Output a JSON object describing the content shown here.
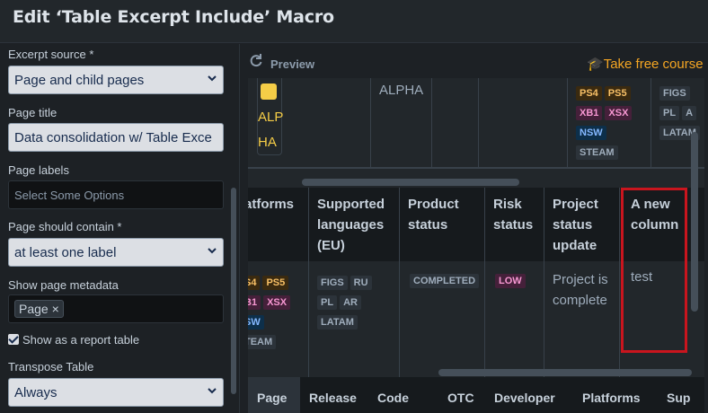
{
  "title": "Edit ‘Table Excerpt Include’ Macro",
  "form": {
    "excerpt_source": {
      "label": "Excerpt source *",
      "value": "Page and child pages"
    },
    "page_title": {
      "label": "Page title",
      "value": "Data consolidation w/ Table Exce"
    },
    "page_labels": {
      "label": "Page labels",
      "placeholder": "Select Some Options"
    },
    "page_should_contain": {
      "label": "Page should contain *",
      "value": "at least one label"
    },
    "show_page_metadata": {
      "label": "Show page metadata",
      "chip": "Page",
      "chip_remove": "×"
    },
    "show_as_report": {
      "label": "Show as a report table",
      "checked": true
    },
    "transpose": {
      "label": "Transpose Table",
      "value": "Always"
    }
  },
  "preview": {
    "label": "Preview",
    "course_link": "Take free course",
    "top_row": {
      "alp_lines": [
        "ALP",
        "HA"
      ],
      "alpha": "ALPHA",
      "tags_col1": [
        [
          "PS4",
          "PS5"
        ],
        [
          "XB1",
          "XSX"
        ],
        [
          "NSW"
        ],
        [
          "STEAM"
        ]
      ],
      "tags_col2": [
        [
          "FIGS"
        ],
        [
          "PL",
          "A"
        ],
        [
          "LATAM"
        ]
      ]
    },
    "headers": [
      "atforms",
      "Supported languages (EU)",
      "Product status",
      "Risk status",
      "Project status update",
      "A new column"
    ],
    "header_lines": {
      "c0": [
        "atforms"
      ],
      "c1": [
        "Supported",
        "languages",
        "(EU)"
      ],
      "c2": [
        "Product",
        "status"
      ],
      "c3": [
        "Risk",
        "status"
      ],
      "c4": [
        "Project",
        "status",
        "update"
      ],
      "c5": [
        "A new",
        "column"
      ]
    },
    "row": {
      "platform_tags": [
        [
          "S4",
          "PS5"
        ],
        [
          "B1",
          "XSX"
        ],
        [
          "SW"
        ],
        [
          "TEAM"
        ]
      ],
      "language_tags": [
        [
          "FIGS",
          "RU"
        ],
        [
          "PL",
          "AR"
        ],
        [
          "LATAM"
        ]
      ],
      "product_status": "COMPLETED",
      "risk_status": "LOW",
      "project_update": [
        "Project is",
        "complete"
      ],
      "new_column": "test"
    },
    "bottom_headers": [
      "Page",
      "Release",
      "Code",
      "OTC",
      "Developer",
      "Platforms",
      "Sup"
    ]
  },
  "colors": {
    "highlight": "#c9151e",
    "accent": "#f5a623"
  }
}
